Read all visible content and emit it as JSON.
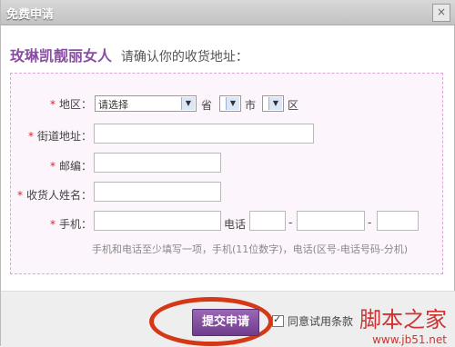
{
  "window": {
    "title": "免费申请",
    "close_glyph": "×"
  },
  "heading": {
    "brand": "玫琳凯靓丽女人",
    "subtitle": "请确认你的收货地址："
  },
  "form": {
    "required_mark": "*",
    "region": {
      "label": "地区：",
      "select_value": "请选择",
      "province_unit": "省",
      "city_unit": "市",
      "district_unit": "区",
      "arrow": "▼"
    },
    "street": {
      "label": "街道地址：",
      "value": ""
    },
    "postcode": {
      "label": "邮编：",
      "value": ""
    },
    "name": {
      "label": "收货人姓名：",
      "value": ""
    },
    "mobile": {
      "label": "手机：",
      "value": ""
    },
    "phone": {
      "label": "电话",
      "separator": "-"
    },
    "hint": "手机和电话至少填写一项，手机(11位数字)，电话(区号-电话号码-分机)"
  },
  "footer": {
    "submit_label": "提交申请",
    "agree_label": "同意试用条款"
  },
  "watermark": {
    "brand": "脚本之家",
    "url": "www.jb51.net"
  },
  "colors": {
    "brand_purple": "#8a4fa5",
    "submit_bg": "#6f3d8c",
    "required_red": "#e02020",
    "annotation_circle": "#d53816"
  }
}
